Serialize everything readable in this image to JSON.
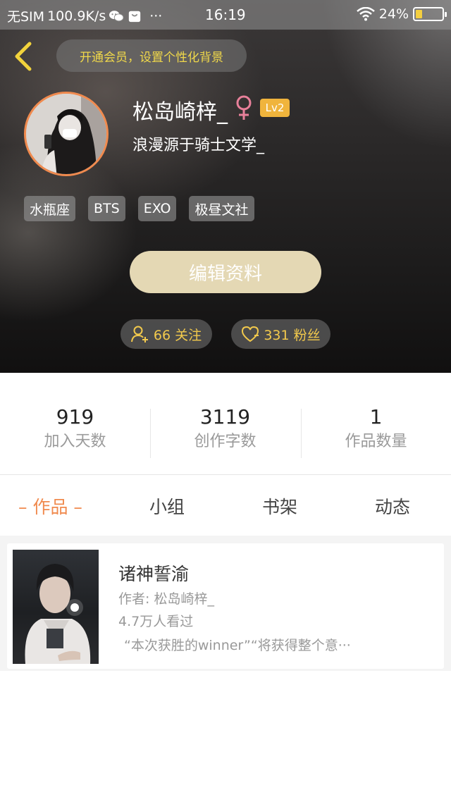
{
  "status_bar": {
    "carrier": "无SIM",
    "speed": "100.9K/s",
    "dots": "···",
    "time": "16:19",
    "battery_text": "24%",
    "battery_level": 0.24,
    "icons": [
      "wechat-icon",
      "shopping-bag-icon",
      "wifi-icon",
      "battery-icon"
    ]
  },
  "header": {
    "vip_banner": "开通会员，设置个性化背景",
    "username": "松岛崎梓_",
    "gender": "female",
    "level": "Lv2",
    "signature": "浪漫源于骑士文学_",
    "tags": [
      "水瓶座",
      "BTS",
      "EXO",
      "极昼文社"
    ],
    "edit_button": "编辑资料",
    "following": "66 关注",
    "fans": "331 粉丝",
    "colors": {
      "accent": "#f08a4e",
      "gold": "#f2c94c",
      "level_badge": "#f0b43c",
      "edit_button": "#e4d8b4"
    }
  },
  "stats": [
    {
      "value": "919",
      "label": "加入天数"
    },
    {
      "value": "3119",
      "label": "创作字数"
    },
    {
      "value": "1",
      "label": "作品数量"
    }
  ],
  "tabs": {
    "works": "– 作品 –",
    "groups": "小组",
    "bookshelf": "书架",
    "activity": "动态"
  },
  "works": [
    {
      "title": "诸神誓渝",
      "author": "作者: 松岛崎梓_",
      "views": "4.7万人看过",
      "excerpt": "“本次获胜的winner”“将获得整个意···"
    }
  ]
}
